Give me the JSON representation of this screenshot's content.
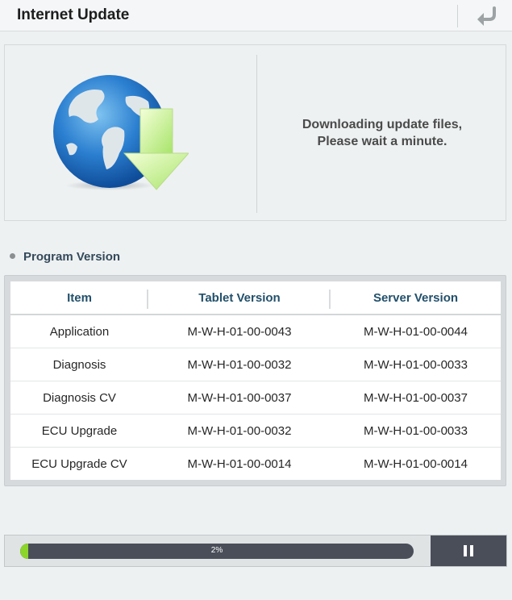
{
  "header": {
    "title": "Internet Update",
    "back_icon": "back-arrow-icon"
  },
  "banner": {
    "icon": "globe-download-icon",
    "message_line1": "Downloading update files,",
    "message_line2": "Please wait a minute."
  },
  "program_version": {
    "title": "Program Version",
    "columns": [
      "Item",
      "Tablet Version",
      "Server Version"
    ],
    "rows": [
      [
        "Application",
        "M-W-H-01-00-0043",
        "M-W-H-01-00-0044"
      ],
      [
        "Diagnosis",
        "M-W-H-01-00-0032",
        "M-W-H-01-00-0033"
      ],
      [
        "Diagnosis CV",
        "M-W-H-01-00-0037",
        "M-W-H-01-00-0037"
      ],
      [
        "ECU Upgrade",
        "M-W-H-01-00-0032",
        "M-W-H-01-00-0033"
      ],
      [
        "ECU Upgrade CV",
        "M-W-H-01-00-0014",
        "M-W-H-01-00-0014"
      ]
    ]
  },
  "progress": {
    "percent": 2,
    "label": "2%",
    "pause_icon": "pause-icon"
  },
  "colors": {
    "progress_fill": "#8cd62a",
    "progress_track": "#4a4e59",
    "header_text": "#22506b"
  }
}
